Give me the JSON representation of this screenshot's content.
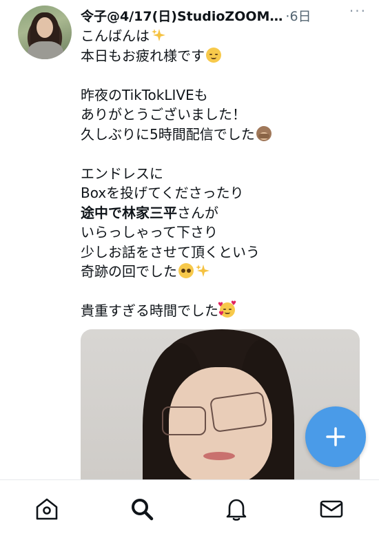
{
  "tweet": {
    "author_name": "令子@4/17(日)StudioZOOM…",
    "separator": "·",
    "timestamp": "6日",
    "more_label": "···",
    "lines": [
      {
        "text": "こんばんは",
        "emoji": "sparkles"
      },
      {
        "text": "本日もお疲れ様です",
        "emoji": "relieved-face"
      },
      {
        "blank": true
      },
      {
        "text": "昨夜のTikTokLIVEも"
      },
      {
        "text": "ありがとうございました！"
      },
      {
        "text": "久しぶりに5時間配信でした",
        "emoji": "speak-no-evil-monkey"
      },
      {
        "blank": true
      },
      {
        "text": "エンドレスに"
      },
      {
        "text": "Boxを投げてくださったり"
      },
      {
        "bold": "途中で林家三平",
        "text": "さんが"
      },
      {
        "text": "いらっしゃって下さり"
      },
      {
        "text": "少しお話をさせて頂くという"
      },
      {
        "text": "奇跡の回でした",
        "emoji": "pleading-face",
        "emoji2": "sparkles"
      },
      {
        "blank": true
      },
      {
        "text": "貴重すぎる時間でした",
        "emoji": "smiling-face-with-hearts"
      }
    ]
  },
  "compose_button": {
    "icon": "plus-icon"
  },
  "tabbar": {
    "items": [
      {
        "name": "home",
        "icon": "home-icon"
      },
      {
        "name": "search",
        "icon": "search-icon",
        "active": true
      },
      {
        "name": "notifications",
        "icon": "bell-icon"
      },
      {
        "name": "messages",
        "icon": "mail-icon"
      }
    ]
  },
  "colors": {
    "accent": "#4a9be8",
    "text": "#0f1419",
    "secondary": "#536471"
  }
}
